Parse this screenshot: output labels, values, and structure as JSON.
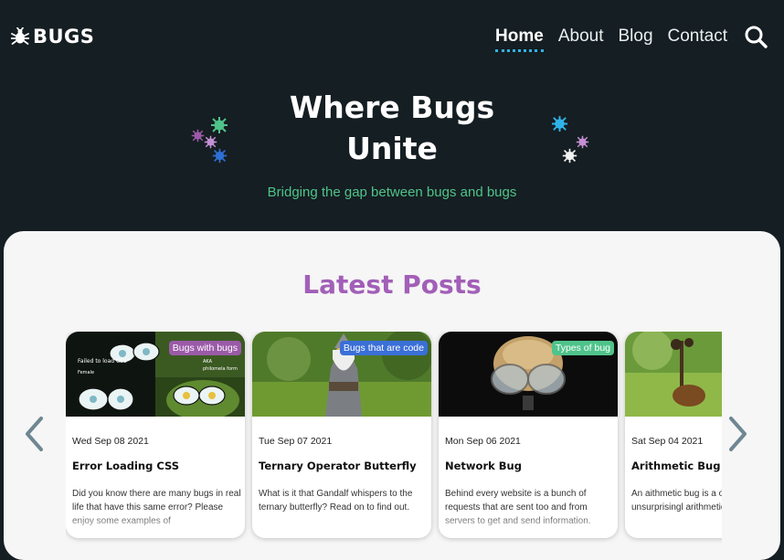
{
  "header": {
    "logo_text": "BUGS",
    "logo_icon": "bug-icon",
    "nav": [
      {
        "label": "Home",
        "active": true
      },
      {
        "label": "About",
        "active": false
      },
      {
        "label": "Blog",
        "active": false
      },
      {
        "label": "Contact",
        "active": false
      }
    ],
    "search_icon": "search-icon"
  },
  "hero": {
    "title_line1": "Where Bugs",
    "title_line2": "Unite",
    "subtitle": "Bridging the gap between bugs and bugs"
  },
  "posts_section": {
    "title": "Latest Posts",
    "prev_icon": "chevron-left-icon",
    "next_icon": "chevron-right-icon",
    "posts": [
      {
        "tag": "Bugs with bugs",
        "tag_color": "#9b5aa8",
        "date": "Wed Sep 08 2021",
        "title": "Error Loading CSS",
        "excerpt": "Did you know there are many bugs in real life that have this same error? Please enjoy some examples of",
        "image_text_1": "Failed to load CSS",
        "image_text_2": "Female ",
        "image_text_3": "AKA",
        "image_text_4": "philomela form"
      },
      {
        "tag": "Bugs that are code",
        "tag_color": "#3a6fd8",
        "date": "Tue Sep 07 2021",
        "title": "Ternary Operator Butterfly",
        "excerpt": "What is it that Gandalf whispers to the ternary butterfly? Read on to find out."
      },
      {
        "tag": "Types of bug",
        "tag_color": "#4fc38a",
        "date": "Mon Sep 06 2021",
        "title": "Network Bug",
        "excerpt": "Behind every website is a bunch of requests that are sent too and from servers to get and send information."
      },
      {
        "tag": "",
        "tag_color": "",
        "date": "Sat Sep 04 2021",
        "title": "Arithmetic Bug",
        "excerpt": "An aithmetic bug is a one that unsurprisingl arithmetic. A super co"
      }
    ]
  },
  "colors": {
    "background": "#151e22",
    "accent_green": "#4fc38a",
    "accent_purple": "#a25fb8",
    "active_underline": "#2fb3e8"
  }
}
